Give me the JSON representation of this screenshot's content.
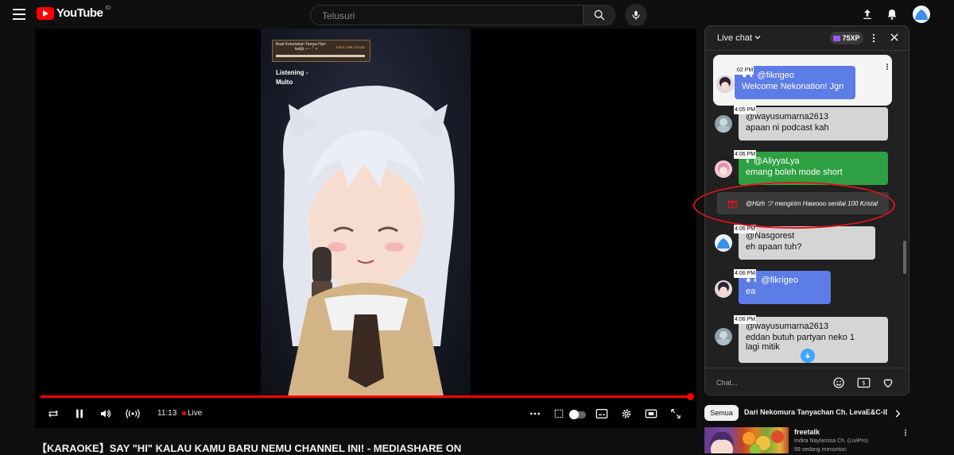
{
  "header": {
    "logo_text": "YouTube",
    "region": "ID",
    "search_placeholder": "Telusuri"
  },
  "video": {
    "donation_title": "Buat Kebutuhan Tamya Hari",
    "donation_subtitle": "twitjb ⋆~ ·˚ ✧",
    "donation_amount": "IDR 0 / IDR 270.000",
    "now_playing": "Listening -",
    "now_playing_song": "Multo",
    "time": "11:13",
    "live_label": "Live",
    "title": "【KARAOKE】SAY \"HI\" KALAU KAMU BARU NEMU CHANNEL INI! - MEDIASHARE ON"
  },
  "chat": {
    "title": "Live chat",
    "xp": "75XP",
    "input_placeholder": "Chat...",
    "messages": [
      {
        "time": ":02 PM",
        "author": "@fikrigeo",
        "text": "Welcome Nekonation! Jgn",
        "color": "#5c7ce6"
      },
      {
        "time": "4:05 PM",
        "author": "@wayusumarna2613",
        "text": "apaan ni podcast kah",
        "color": "#d5d5d5"
      },
      {
        "time": "4:06 PM",
        "author": "@AliyyaLya",
        "text": "emang boleh mode short",
        "color": "#2ea043"
      },
      {
        "time": "4:06 PM",
        "author": "@Nasgorest",
        "text": "eh apaan tuh?",
        "color": "#d5d5d5"
      },
      {
        "time": "4:06 PM",
        "author": "@fikrigeo",
        "text": "ea",
        "color": "#5c7ce6"
      },
      {
        "time": "4:06 PM",
        "author": "@wayusumarna2613",
        "text": "eddan butuh partyan neko 1",
        "text2": "lagi mitik",
        "color": "#d5d5d5"
      }
    ],
    "gift": "@Hizh ツ   mengirim Hawooo senilai 100 Kristal"
  },
  "chips": {
    "active": "Semua",
    "next": "Dari Nekomura Tanyachan Ch. LevaE&C-ID"
  },
  "recommendation": {
    "title": "freetalk",
    "channel": "Indira Naylarissa Ch. (LiviPro)",
    "views": "99 sedang menonton"
  },
  "colors": {
    "accent_red": "#ff0000",
    "annotation_red": "#e0141d",
    "chat_bg": "#212121",
    "link_blue": "#3ea6ff"
  }
}
